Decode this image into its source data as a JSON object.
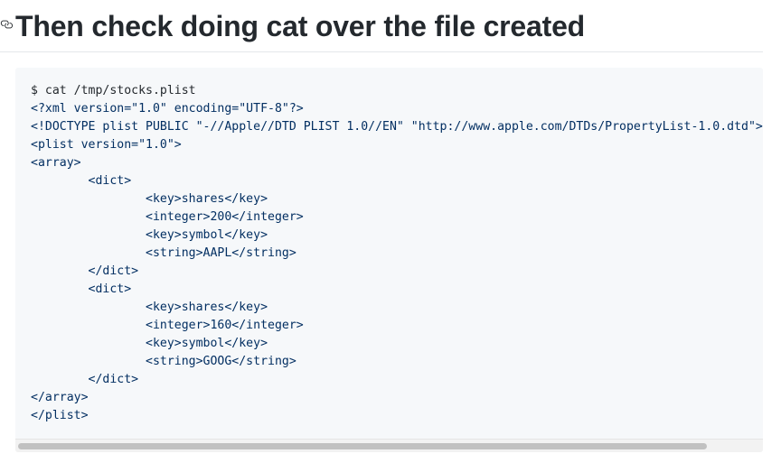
{
  "heading": {
    "title": "Then check doing cat over the file created",
    "anchor_icon": "link-icon"
  },
  "code_block": {
    "lines": [
      {
        "text": "$ cat /tmp/stocks.plist",
        "kind": "cmd"
      },
      {
        "text": "<?xml version=\"1.0\" encoding=\"UTF-8\"?>",
        "kind": "xml"
      },
      {
        "text": "<!DOCTYPE plist PUBLIC \"-//Apple//DTD PLIST 1.0//EN\" \"http://www.apple.com/DTDs/PropertyList-1.0.dtd\">",
        "kind": "xml"
      },
      {
        "text": "<plist version=\"1.0\">",
        "kind": "xml"
      },
      {
        "text": "<array>",
        "kind": "xml"
      },
      {
        "text": "        <dict>",
        "kind": "xml"
      },
      {
        "text": "                <key>shares</key>",
        "kind": "xml"
      },
      {
        "text": "                <integer>200</integer>",
        "kind": "xml"
      },
      {
        "text": "                <key>symbol</key>",
        "kind": "xml"
      },
      {
        "text": "                <string>AAPL</string>",
        "kind": "xml"
      },
      {
        "text": "        </dict>",
        "kind": "xml"
      },
      {
        "text": "        <dict>",
        "kind": "xml"
      },
      {
        "text": "                <key>shares</key>",
        "kind": "xml"
      },
      {
        "text": "                <integer>160</integer>",
        "kind": "xml"
      },
      {
        "text": "                <key>symbol</key>",
        "kind": "xml"
      },
      {
        "text": "                <string>GOOG</string>",
        "kind": "xml"
      },
      {
        "text": "        </dict>",
        "kind": "xml"
      },
      {
        "text": "</array>",
        "kind": "xml"
      },
      {
        "text": "</plist>",
        "kind": "xml"
      }
    ],
    "scrollbar_position": 0
  },
  "colors": {
    "heading_text": "#24292e",
    "code_background": "#f6f8fa",
    "xml_text": "#032f62",
    "command_text": "#24292e"
  }
}
